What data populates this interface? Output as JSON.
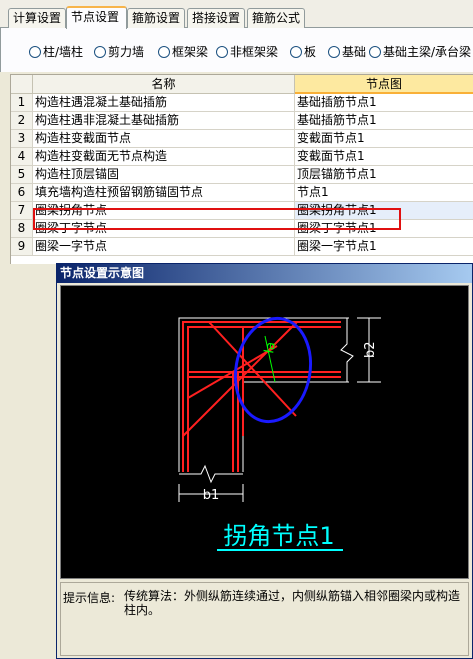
{
  "tabs": [
    {
      "label": "计算设置",
      "active": false
    },
    {
      "label": "节点设置",
      "active": true
    },
    {
      "label": "箍筋设置",
      "active": false
    },
    {
      "label": "搭接设置",
      "active": false
    },
    {
      "label": "箍筋公式",
      "active": false
    }
  ],
  "radios": [
    "柱/墙柱",
    "剪力墙",
    "框架梁",
    "非框架梁",
    "板",
    "基础",
    "基础主梁/承台梁"
  ],
  "grid": {
    "headers": [
      "",
      "名称",
      "节点图"
    ],
    "rows": [
      {
        "num": "1",
        "name": "构造柱遇混凝土基础插筋",
        "node": "基础插筋节点1"
      },
      {
        "num": "2",
        "name": "构造柱遇非混凝土基础插筋",
        "node": "基础插筋节点1"
      },
      {
        "num": "3",
        "name": "构造柱变截面节点",
        "node": "变截面节点1"
      },
      {
        "num": "4",
        "name": "构造柱变截面无节点构造",
        "node": "变截面节点1"
      },
      {
        "num": "5",
        "name": "构造柱顶层锚固",
        "node": "顶层锚筋节点1"
      },
      {
        "num": "6",
        "name": "填充墙构造柱预留钢筋锚固节点",
        "node": "节点1"
      },
      {
        "num": "7",
        "name": "圈梁拐角节点",
        "node": "圈梁拐角节点1",
        "selected": true
      },
      {
        "num": "8",
        "name": "圈梁丁字节点",
        "node": "圈梁丁字节点1"
      },
      {
        "num": "9",
        "name": "圈梁一字节点",
        "node": "圈梁一字节点1"
      }
    ]
  },
  "dialog": {
    "title": "节点设置示意图",
    "diagram": {
      "labels": {
        "la": "la",
        "b1": "b1",
        "b2": "b2"
      },
      "caption": "拐角节点1",
      "colors": {
        "bg": "#000000",
        "rebar": "#ff2020",
        "outline": "#ffffff",
        "circle": "#1a1aff",
        "dim_text": "#00ff00",
        "caption": "#00ffff"
      }
    },
    "info_label": "提示信息:",
    "info_text": "传统算法：外侧纵筋连续通过，内侧纵筋锚入相邻圈梁内或构造柱内。"
  },
  "colors": {
    "selection_box": "#e01010",
    "tab_active_accent": "#f7b44a"
  }
}
